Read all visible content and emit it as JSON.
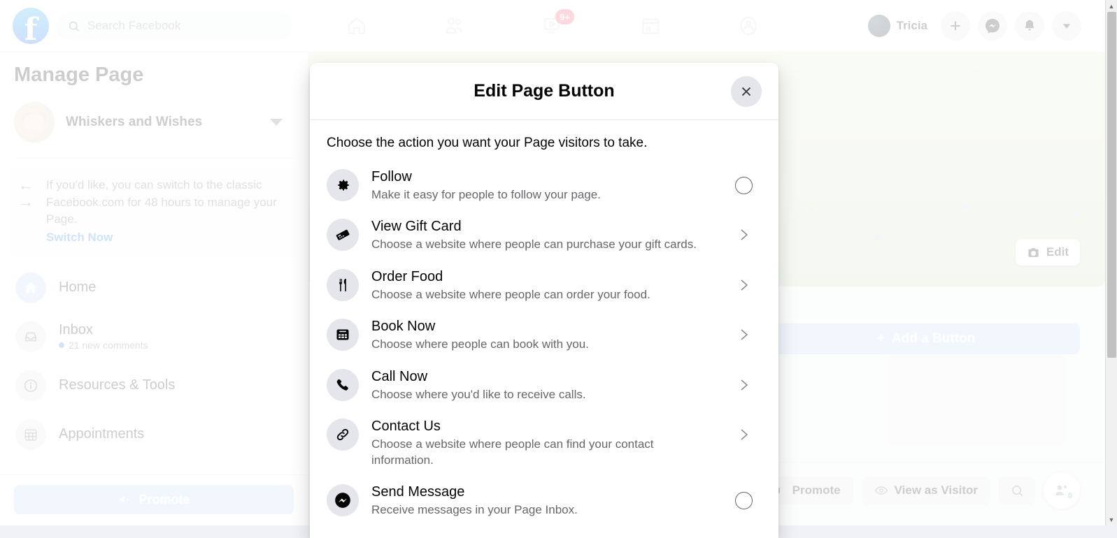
{
  "topbar": {
    "logo_icon": "facebook-logo",
    "logo_letter": "f",
    "search": {
      "icon": "search-icon",
      "placeholder": "Search Facebook",
      "value": "Search Facebook"
    },
    "nav_icons": [
      {
        "name": "home-icon",
        "label": "Home"
      },
      {
        "name": "friends-icon",
        "label": "Friends"
      },
      {
        "name": "video-icon",
        "label": "Video",
        "badge": "9+"
      },
      {
        "name": "marketplace-icon",
        "label": "Marketplace"
      },
      {
        "name": "groups-icon",
        "label": "Groups"
      }
    ],
    "user": {
      "name": "Tricia",
      "avatar_icon": "user-avatar"
    },
    "actions": [
      {
        "name": "create-button",
        "icon": "plus-icon"
      },
      {
        "name": "messenger-button",
        "icon": "messenger-icon"
      },
      {
        "name": "notifications-button",
        "icon": "bell-icon"
      },
      {
        "name": "account-menu-button",
        "icon": "chevron-down-icon"
      }
    ]
  },
  "sidebar": {
    "title": "Manage Page",
    "page": {
      "name": "Whiskers and Wishes",
      "avatar_icon": "cat-avatar",
      "caret_icon": "caret-down-icon"
    },
    "notice": {
      "icon": "switch-arrows-icon",
      "text": "If you'd like, you can switch to the classic Facebook.com for 48 hours to manage your Page.",
      "link": "Switch Now"
    },
    "items": [
      {
        "label": "Home",
        "icon": "home-icon",
        "active": true,
        "sub": ""
      },
      {
        "label": "Inbox",
        "icon": "inbox-icon",
        "active": false,
        "sub": "21 new comments"
      },
      {
        "label": "Resources & Tools",
        "icon": "info-icon",
        "active": false,
        "sub": ""
      },
      {
        "label": "Appointments",
        "icon": "calendar-icon",
        "active": false,
        "sub": ""
      }
    ],
    "promote": {
      "label": "Promote",
      "icon": "megaphone-icon"
    }
  },
  "content": {
    "cover": {
      "edit_label": "Edit",
      "edit_icon": "camera-icon",
      "photo": "kitten-in-lavender-field"
    },
    "add_button": {
      "label": "Add a Button",
      "icon": "plus-icon"
    },
    "actions": [
      {
        "label": "Promote",
        "icon": "megaphone-icon",
        "name": "promote-button"
      },
      {
        "label": "View as Visitor",
        "icon": "eye-icon",
        "name": "view-as-visitor-button"
      },
      {
        "label": "",
        "icon": "search-icon",
        "name": "page-search-button"
      }
    ],
    "people_fab": {
      "icon": "people-icon",
      "count": "0"
    }
  },
  "modal": {
    "title": "Edit Page Button",
    "close_icon": "close-icon",
    "prompt": "Choose the action you want your Page visitors to take.",
    "options": [
      {
        "title": "Follow",
        "desc": "Make it easy for people to follow your page.",
        "icon": "gear-icon",
        "control": "radio"
      },
      {
        "title": "View Gift Card",
        "desc": "Choose a website where people can purchase your gift cards.",
        "icon": "gift-card-icon",
        "control": "chevron"
      },
      {
        "title": "Order Food",
        "desc": "Choose a website where people can order your food.",
        "icon": "utensils-icon",
        "control": "chevron"
      },
      {
        "title": "Book Now",
        "desc": "Choose where people can book with you.",
        "icon": "calendar-icon",
        "control": "chevron"
      },
      {
        "title": "Call Now",
        "desc": "Choose where you'd like to receive calls.",
        "icon": "phone-icon",
        "control": "chevron"
      },
      {
        "title": "Contact Us",
        "desc": "Choose a website where people can find your contact information.",
        "icon": "link-icon",
        "control": "chevron"
      },
      {
        "title": "Send Message",
        "desc": "Receive messages in your Page Inbox.",
        "icon": "messenger-icon",
        "control": "radio"
      }
    ]
  },
  "colors": {
    "brand_blue": "#0866ff",
    "link_blue": "#1b74e4",
    "muted_blue": "#bcd4f5",
    "badge_red": "#f3425f",
    "text_primary": "#050505",
    "text_secondary": "#65676b",
    "surface": "#ffffff",
    "app_bg": "#f0f2f5",
    "icon_bg": "#e4e6eb"
  }
}
